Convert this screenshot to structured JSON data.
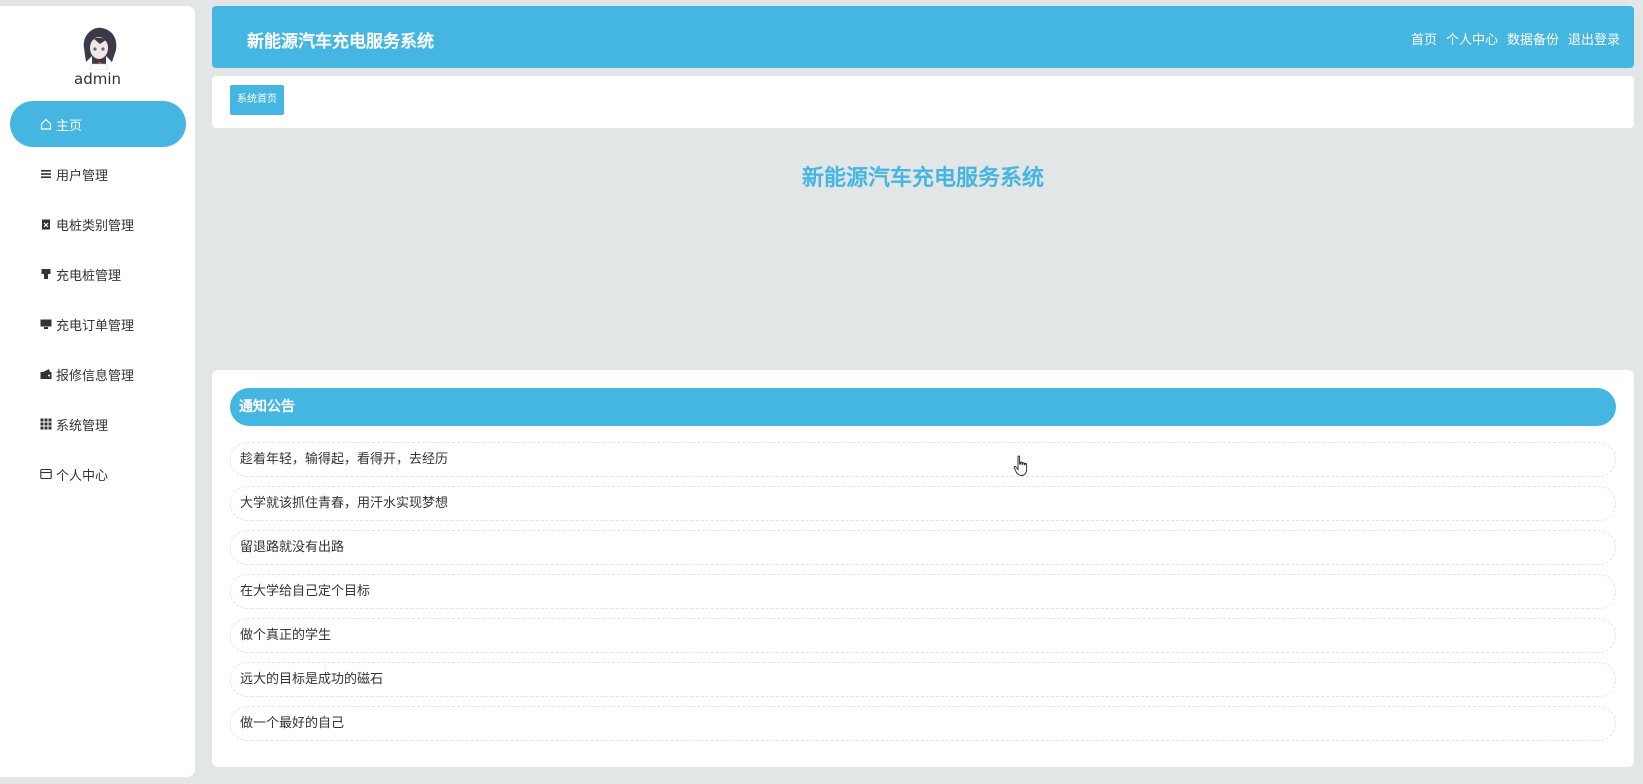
{
  "sidebar": {
    "user_name": "admin",
    "items": [
      {
        "label": "主页",
        "icon": "home-icon",
        "active": true
      },
      {
        "label": "用户管理",
        "icon": "list-icon"
      },
      {
        "label": "电桩类别管理",
        "icon": "clipboard-icon"
      },
      {
        "label": "充电桩管理",
        "icon": "charger-icon"
      },
      {
        "label": "充电订单管理",
        "icon": "monitor-icon"
      },
      {
        "label": "报修信息管理",
        "icon": "wallet-icon"
      },
      {
        "label": "系统管理",
        "icon": "grid-icon"
      },
      {
        "label": "个人中心",
        "icon": "card-icon"
      }
    ]
  },
  "header": {
    "title": "新能源汽车充电服务系统",
    "nav": [
      "首页",
      "个人中心",
      "数据备份",
      "退出登录"
    ]
  },
  "breadcrumb": {
    "current": "系统首页"
  },
  "main": {
    "title": "新能源汽车充电服务系统"
  },
  "notices": {
    "title": "通知公告",
    "items": [
      "趁着年轻，输得起，看得开，去经历",
      "大学就该抓住青春，用汗水实现梦想",
      "留退路就没有出路",
      "在大学给自己定个目标",
      "做个真正的学生",
      "远大的目标是成功的磁石",
      "做一个最好的自己"
    ]
  },
  "colors": {
    "accent": "#45b6e2",
    "background": "#e2e6e6",
    "panel": "#ffffff"
  }
}
